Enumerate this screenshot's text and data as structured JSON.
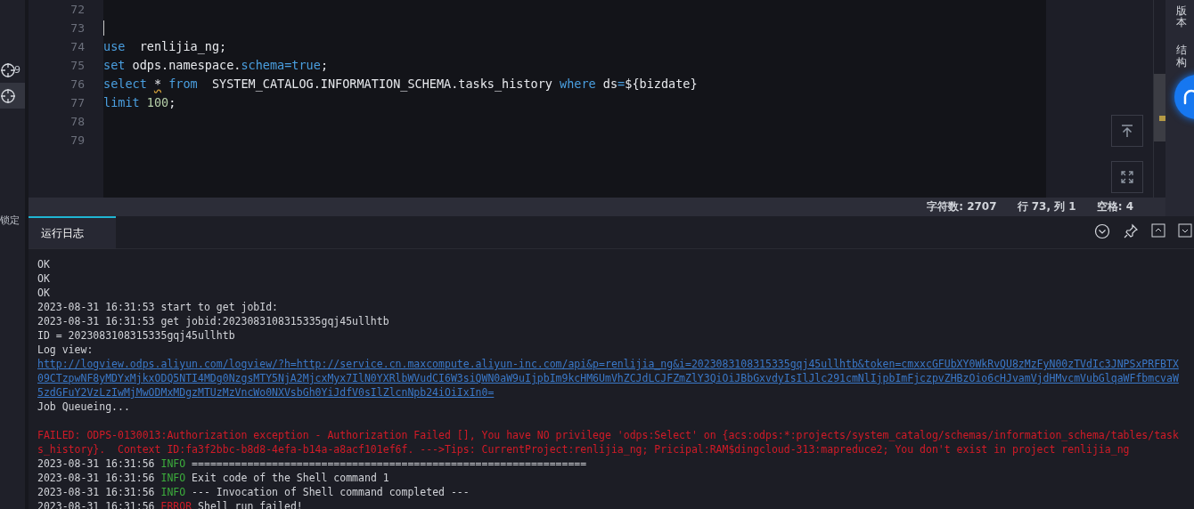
{
  "left_rail": {
    "items": [
      {
        "kind": "target",
        "label": "9",
        "selected": false
      },
      {
        "kind": "target",
        "selected": true
      }
    ],
    "lock_label": "锁定"
  },
  "editor": {
    "lines": [
      {
        "number": "72"
      },
      {
        "number": "73",
        "cursor": true
      },
      {
        "number": "74",
        "tokens": [
          {
            "kind": "keyword",
            "text": "use"
          },
          {
            "kind": "plain",
            "text": "  renlijia_ng;"
          }
        ]
      },
      {
        "number": "75",
        "tokens": [
          {
            "kind": "keyword",
            "text": "set"
          },
          {
            "kind": "plain",
            "text": " odps.namespace."
          },
          {
            "kind": "keyword",
            "text": "schema"
          },
          {
            "kind": "operator",
            "text": "="
          },
          {
            "kind": "keyword",
            "text": "true"
          },
          {
            "kind": "plain",
            "text": ";"
          }
        ]
      },
      {
        "number": "76",
        "tokens": [
          {
            "kind": "keyword",
            "text": "select "
          },
          {
            "kind": "warning",
            "text": "*"
          },
          {
            "kind": "keyword",
            "text": " from"
          },
          {
            "kind": "plain",
            "text": "  SYSTEM_CATALOG.INFORMATION_SCHEMA.tasks_history "
          },
          {
            "kind": "keyword",
            "text": "where"
          },
          {
            "kind": "plain",
            "text": " ds"
          },
          {
            "kind": "operator",
            "text": "="
          },
          {
            "kind": "plain",
            "text": "${bizdate}"
          }
        ]
      },
      {
        "number": "77",
        "tokens": [
          {
            "kind": "keyword",
            "text": "limit "
          },
          {
            "kind": "number",
            "text": "100"
          },
          {
            "kind": "plain",
            "text": ";"
          }
        ]
      },
      {
        "number": "78"
      },
      {
        "number": "79"
      }
    ]
  },
  "right_rail": {
    "items": [
      "版本",
      "结构"
    ]
  },
  "status_bar": {
    "items": [
      "字符数: 2707",
      "行 73, 列 1",
      "空格: 4"
    ]
  },
  "panel": {
    "tabs": [
      {
        "label": "运行日志",
        "selected": true
      }
    ],
    "log": [
      {
        "kind": "plain",
        "text": "OK"
      },
      {
        "kind": "plain",
        "text": "OK"
      },
      {
        "kind": "plain",
        "text": "OK"
      },
      {
        "kind": "plain",
        "text": "2023-08-31 16:31:53 start to get jobId:"
      },
      {
        "kind": "plain",
        "text": "2023-08-31 16:31:53 get jobid:2023083108315335gqj45ullhtb"
      },
      {
        "kind": "plain",
        "text": "ID = 2023083108315335gqj45ullhtb"
      },
      {
        "kind": "plain",
        "text": "Log view:"
      },
      {
        "kind": "link",
        "text": "http://logview.odps.aliyun.com/logview/?h=http://service.cn.maxcompute.aliyun-inc.com/api&p=renlijia_ng&i=2023083108315335gqj45ullhtb&token=cmxxcGFUbXY0WkRvQU8zMzFyN00zTVdIc3JNPSxPRFBTX09CTzpwNF8yMDYxMjkxODQ5NTI4MDg0NzgsMTY5NjA2MjcxMyx7IlN0YXRlbWVudCI6W3siQWN0aW9uIjpbIm9kcHM6UmVhZCJdLCJFZmZlY3QiOiJBbGxvdyIsIlJlc291cmNlIjpbImFjczpvZHBzOio6cHJvamVjdHMvcmVubGlqaWFfbmcvaW5zdGFuY2VzLzIwMjMwODMxMDgzMTUzMzVncWo0NXVsbGh0YiJdfV0sIlZlcnNpb24iOiIxIn0="
      },
      {
        "kind": "plain",
        "text": "Job Queueing..."
      },
      {
        "kind": "blank"
      },
      {
        "kind": "failed",
        "text": "FAILED: ODPS-0130013:Authorization exception - Authorization Failed [], You have NO privilege 'odps:Select' on {acs:odps:*:projects/system_catalog/schemas/information_schema/tables/tasks_history}.  Context ID:fa3f2bbc-b8d8-4efa-b14a-a8acf101ef6f. --->Tips: CurrentProject:renlijia_ng; Pricipal:RAM$dingcloud-313:mapreduce2; You don't exist in project renlijia_ng"
      },
      {
        "kind": "leveled",
        "time": "2023-08-31 16:31:56",
        "level": "INFO",
        "color": "#3cad3c",
        "message": "================================================================"
      },
      {
        "kind": "leveled",
        "time": "2023-08-31 16:31:56",
        "level": "INFO",
        "color": "#3cad3c",
        "message": "Exit code of the Shell command 1"
      },
      {
        "kind": "leveled",
        "time": "2023-08-31 16:31:56",
        "level": "INFO",
        "color": "#3cad3c",
        "message": "--- Invocation of Shell command completed ---"
      },
      {
        "kind": "leveled",
        "time": "2023-08-31 16:31:56",
        "level": "ERROR",
        "color": "#d21b27",
        "message": "Shell run failed!"
      }
    ]
  }
}
